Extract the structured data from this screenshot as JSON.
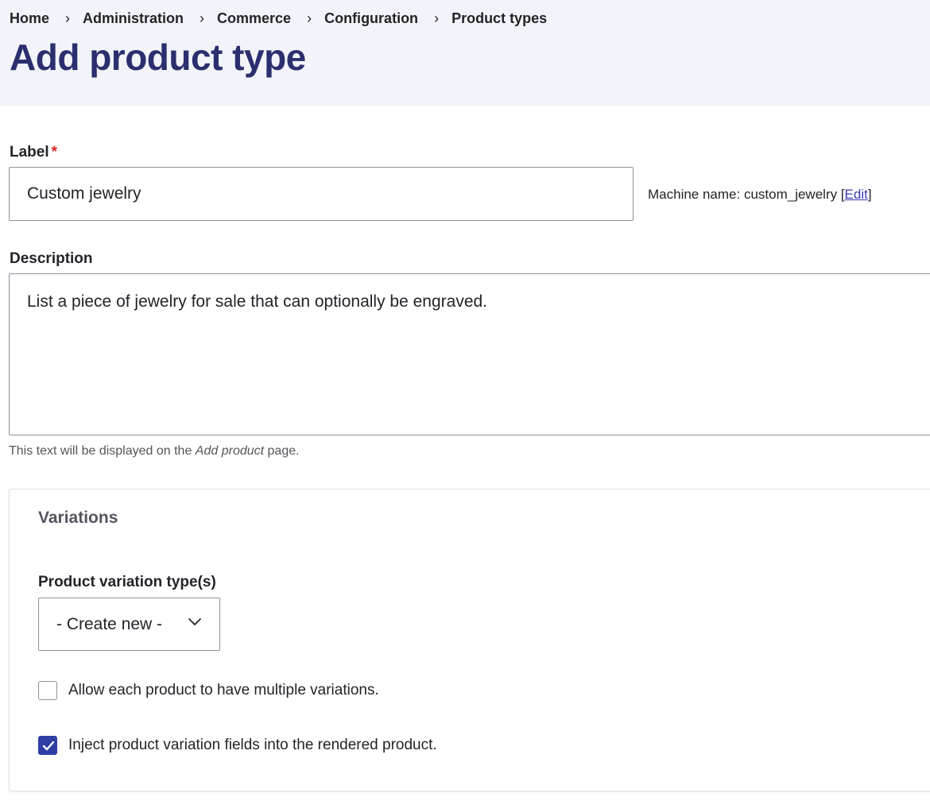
{
  "breadcrumb": {
    "items": [
      "Home",
      "Administration",
      "Commerce",
      "Configuration",
      "Product types"
    ],
    "separator": "›"
  },
  "page": {
    "title": "Add product type"
  },
  "label_field": {
    "label": "Label",
    "required_mark": "*",
    "value": "Custom jewelry",
    "machine_name_prefix": "Machine name: custom_jewelry [",
    "machine_name_edit": "Edit",
    "machine_name_suffix": "]"
  },
  "description_field": {
    "label": "Description",
    "value": "List a piece of jewelry for sale that can optionally be engraved.",
    "help_before": "This text will be displayed on the ",
    "help_emphasis": "Add product",
    "help_after": " page."
  },
  "variations": {
    "title": "Variations",
    "type_label": "Product variation type(s)",
    "type_selected": "- Create new -",
    "multiple_label": "Allow each product to have multiple variations.",
    "multiple_checked": false,
    "inject_label": "Inject product variation fields into the rendered product.",
    "inject_checked": true
  },
  "colors": {
    "title": "#2b2f6e",
    "header_bg": "#f3f4f9",
    "required": "#d72222",
    "link": "#3b3bb3",
    "checkbox_checked": "#2f3fa5"
  }
}
